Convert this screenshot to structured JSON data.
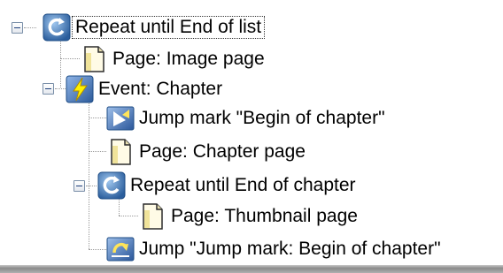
{
  "tree": {
    "nodes": [
      {
        "label": "Repeat until End of list",
        "icon": "repeat-icon",
        "selected": true,
        "expanded": true
      },
      {
        "label": "Page: Image page",
        "icon": "page-icon"
      },
      {
        "label": "Event: Chapter",
        "icon": "event-icon",
        "expanded": true
      },
      {
        "label": "Jump mark \"Begin of chapter\"",
        "icon": "jump-mark-icon"
      },
      {
        "label": "Page: Chapter page",
        "icon": "page-icon"
      },
      {
        "label": "Repeat until End of chapter",
        "icon": "repeat-icon",
        "expanded": true
      },
      {
        "label": "Page: Thumbnail page",
        "icon": "page-icon"
      },
      {
        "label": "Jump \"Jump mark: Begin of chapter\"",
        "icon": "jump-icon"
      }
    ]
  }
}
